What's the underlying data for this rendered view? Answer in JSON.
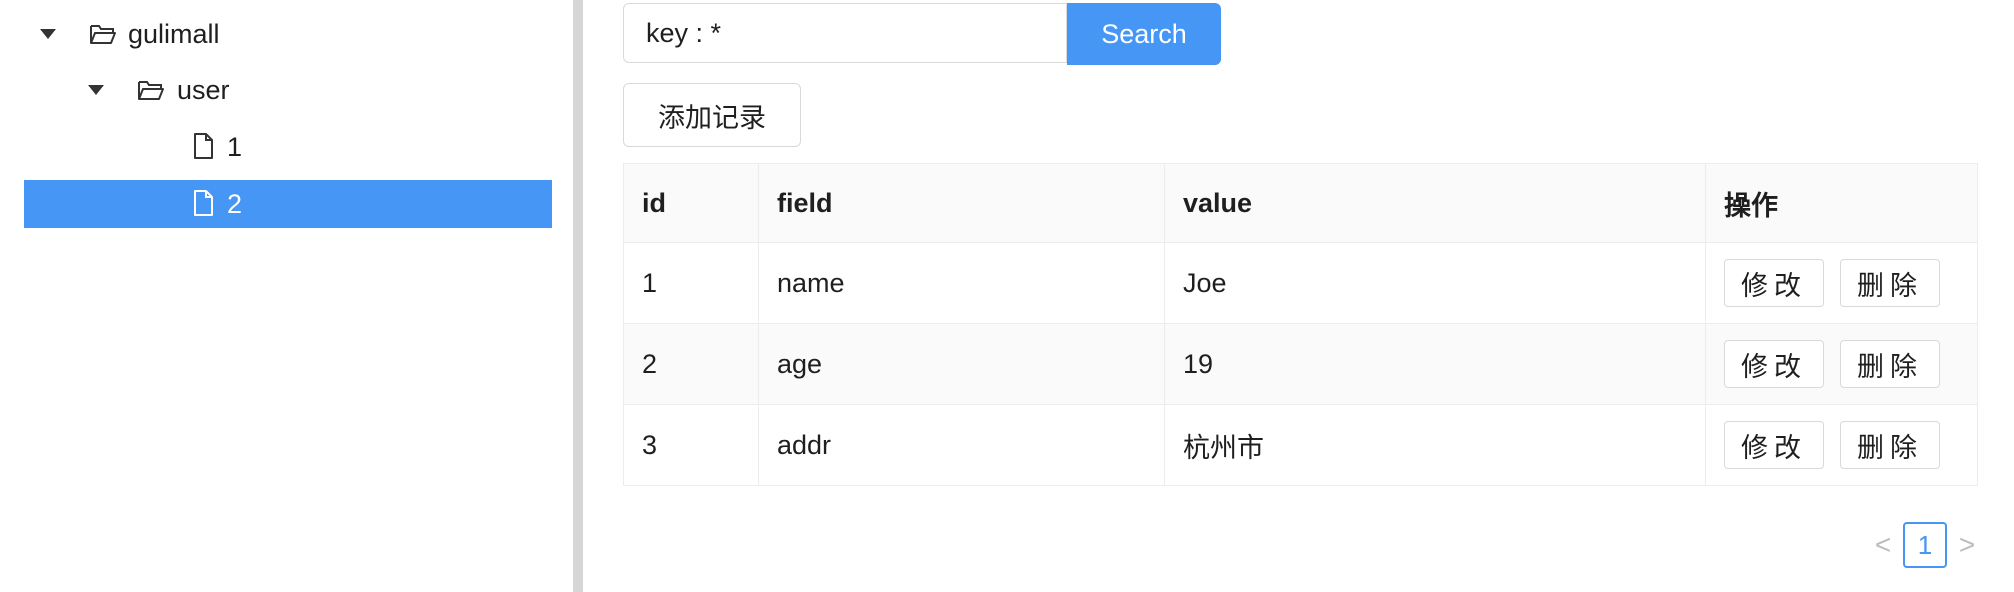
{
  "tree": {
    "root_label": "gulimall",
    "child_label": "user",
    "leaves": [
      {
        "label": "1",
        "selected": false
      },
      {
        "label": "2",
        "selected": true
      }
    ]
  },
  "search": {
    "value": "key : *",
    "button_label": "Search"
  },
  "add_button_label": "添加记录",
  "table": {
    "headers": [
      "id",
      "field",
      "value",
      "操作"
    ],
    "rows": [
      {
        "id": "1",
        "field": "name",
        "value": "Joe"
      },
      {
        "id": "2",
        "field": "age",
        "value": "19"
      },
      {
        "id": "3",
        "field": "addr",
        "value": "杭州市"
      }
    ],
    "edit_label": "修改",
    "delete_label": "删除"
  },
  "pagination": {
    "prev": "<",
    "current": "1",
    "next": ">"
  },
  "colors": {
    "accent": "#4596f5",
    "splitter": "#d6d6d6"
  }
}
